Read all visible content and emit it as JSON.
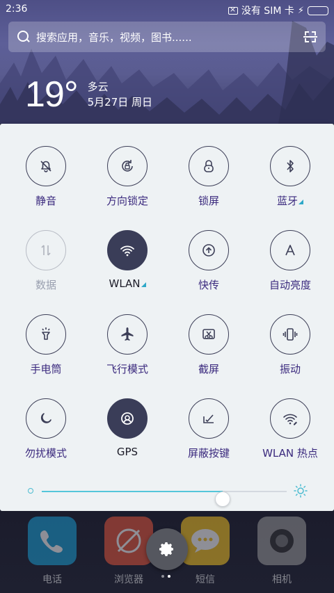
{
  "status_bar": {
    "time": "2:36",
    "sim_status": "没有 SIM 卡",
    "battery_level": 1.0
  },
  "search": {
    "placeholder": "搜索应用，音乐，视频，图书......",
    "left_icon": "search-icon",
    "right_icon": "scan-icon"
  },
  "weather": {
    "temperature": "19°",
    "condition": "多云",
    "date": "5月27日 周日"
  },
  "controls": {
    "tiles": [
      {
        "label": "静音",
        "icon": "bell-off-icon",
        "state": "off"
      },
      {
        "label": "方向锁定",
        "icon": "rotation-lock-icon",
        "state": "off"
      },
      {
        "label": "锁屏",
        "icon": "lock-icon",
        "state": "off"
      },
      {
        "label": "蓝牙",
        "icon": "bluetooth-icon",
        "state": "off",
        "more": true
      },
      {
        "label": "数据",
        "icon": "mobile-data-icon",
        "state": "disabled"
      },
      {
        "label": "WLAN",
        "icon": "wifi-icon",
        "state": "on",
        "more": true
      },
      {
        "label": "快传",
        "icon": "share-upload-icon",
        "state": "off"
      },
      {
        "label": "自动亮度",
        "icon": "auto-brightness-icon",
        "state": "off"
      },
      {
        "label": "手电筒",
        "icon": "flashlight-icon",
        "state": "off"
      },
      {
        "label": "飞行模式",
        "icon": "airplane-icon",
        "state": "off"
      },
      {
        "label": "截屏",
        "icon": "screenshot-icon",
        "state": "off"
      },
      {
        "label": "振动",
        "icon": "vibrate-icon",
        "state": "off"
      },
      {
        "label": "勿扰模式",
        "icon": "moon-icon",
        "state": "off"
      },
      {
        "label": "GPS",
        "icon": "gps-icon",
        "state": "on"
      },
      {
        "label": "屏蔽按键",
        "icon": "block-keys-icon",
        "state": "off"
      },
      {
        "label": "WLAN 热点",
        "icon": "hotspot-icon",
        "state": "off"
      }
    ],
    "brightness": 0.74
  },
  "dock": {
    "apps": [
      {
        "label": "电话",
        "color": "#1aa0d6",
        "icon": "phone-icon"
      },
      {
        "label": "浏览器",
        "color": "#e8563b",
        "icon": "browser-icon"
      },
      {
        "label": "短信",
        "color": "#f6c423",
        "icon": "message-icon"
      },
      {
        "label": "相机",
        "color": "#9a9a9a",
        "icon": "camera-icon"
      }
    ],
    "page_count": 2,
    "current_page": 2
  },
  "colors": {
    "panel_bg": "#eef2f4",
    "tile_active": "#3a3d58",
    "label_accent": "#3b2a7e",
    "slider_accent": "#54c6da"
  }
}
